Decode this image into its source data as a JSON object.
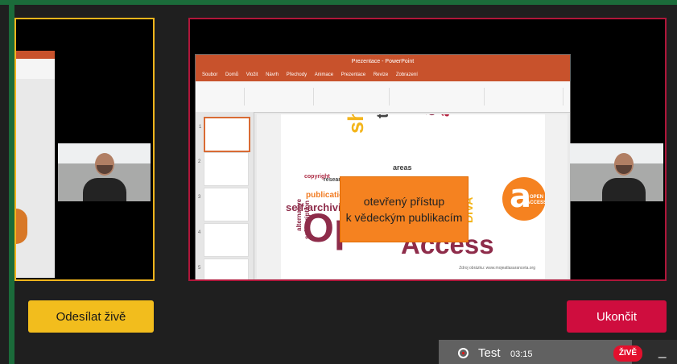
{
  "buttons": {
    "send_live": "Odesílat živě",
    "end_live": "Ukončit"
  },
  "status": {
    "title": "Test",
    "timer": "03:15",
    "live": "ŽIVĚ",
    "minimize": "_"
  },
  "slide": {
    "line1": "otevřený přístup",
    "line2": "k vědeckým publikacím",
    "logo_text": "OPEN ACCESS",
    "source": "Zdroj obrázku: www.mojeatlasaranceta.org"
  },
  "words": [
    "shing",
    "thors",
    "als",
    "articles",
    "areas",
    "copyright",
    "publication",
    "self-archiving",
    "Open",
    "Access",
    "DIVA",
    "alternative",
    "subscription",
    "research"
  ],
  "ribbon_tabs": [
    "Soubor",
    "Domů",
    "Vložit",
    "Návrh",
    "Přechody",
    "Animace",
    "Prezentace",
    "Revize",
    "Zobrazení"
  ],
  "window_title": "Prezentace - PowerPoint"
}
